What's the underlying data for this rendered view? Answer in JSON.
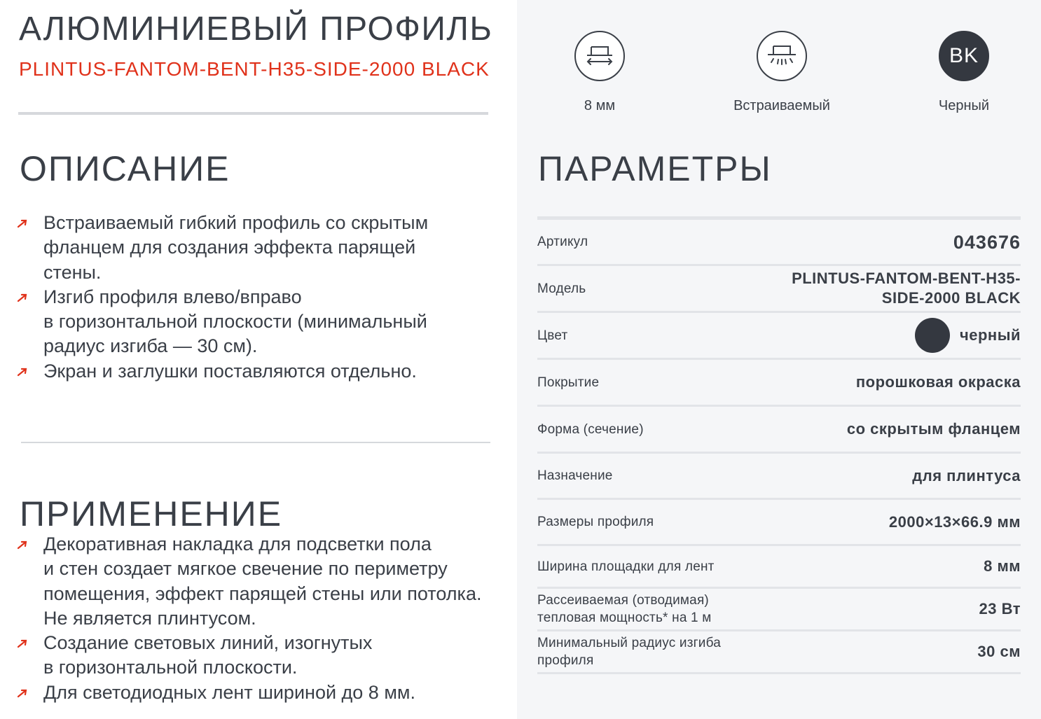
{
  "header": {
    "title": "АЛЮМИНИЕВЫЙ ПРОФИЛЬ",
    "model": "PLINTUS-FANTOM-BENT-H35-SIDE-2000 BLACK"
  },
  "description": {
    "heading": "ОПИСАНИЕ",
    "items": [
      "Встраиваемый гибкий профиль со скрытым\nфланцем для создания эффекта парящей\nстены.",
      "Изгиб профиля влево/вправо\nв горизонтальной плоскости (минимальный\nрадиус изгиба — 30 см).",
      "Экран и заглушки поставляются отдельно."
    ]
  },
  "application": {
    "heading": "ПРИМЕНЕНИЕ",
    "items": [
      "Декоративная накладка для подсветки пола\nи стен создает мягкое свечение по периметру\nпомещения, эффект парящей стены или потолка.\nНе является плинтусом.",
      "Создание световых линий, изогнутых\nв горизонтальной плоскости.",
      "Для светодиодных лент шириной до 8 мм."
    ]
  },
  "features": [
    {
      "icon": "width-profile-icon",
      "label": "8 мм"
    },
    {
      "icon": "recessed-profile-icon",
      "label": "Встраиваемый"
    },
    {
      "icon": "color-badge",
      "badge": "BK",
      "label": "Черный"
    }
  ],
  "parameters": {
    "heading": "ПАРАМЕТРЫ",
    "rows": [
      {
        "key": "Артикул",
        "value": "043676"
      },
      {
        "key": "Модель",
        "value": "PLINTUS-FANTOM-BENT-H35-\nSIDE-2000 BLACK"
      },
      {
        "key": "Цвет",
        "value": "черный"
      },
      {
        "key": "Покрытие",
        "value": "порошковая окраска"
      },
      {
        "key": "Форма (сечение)",
        "value": "со скрытым фланцем"
      },
      {
        "key": "Назначение",
        "value": "для плинтуса"
      },
      {
        "key": "Размеры профиля",
        "value": "2000×13×66.9 мм"
      },
      {
        "key": "Ширина площадки для лент",
        "value": "8 мм"
      },
      {
        "key": "Рассеиваемая (отводимая)\nтепловая мощность* на 1 м",
        "value": "23 Вт"
      },
      {
        "key": "Минимальный радиус изгиба\nпрофиля",
        "value": "30 см"
      }
    ]
  },
  "colors": {
    "accent": "#e0321b",
    "text": "#3a3f47",
    "swatch_black": "#343840",
    "right_panel_bg": "#f5f6f8",
    "divider": "#e2e4e8"
  }
}
